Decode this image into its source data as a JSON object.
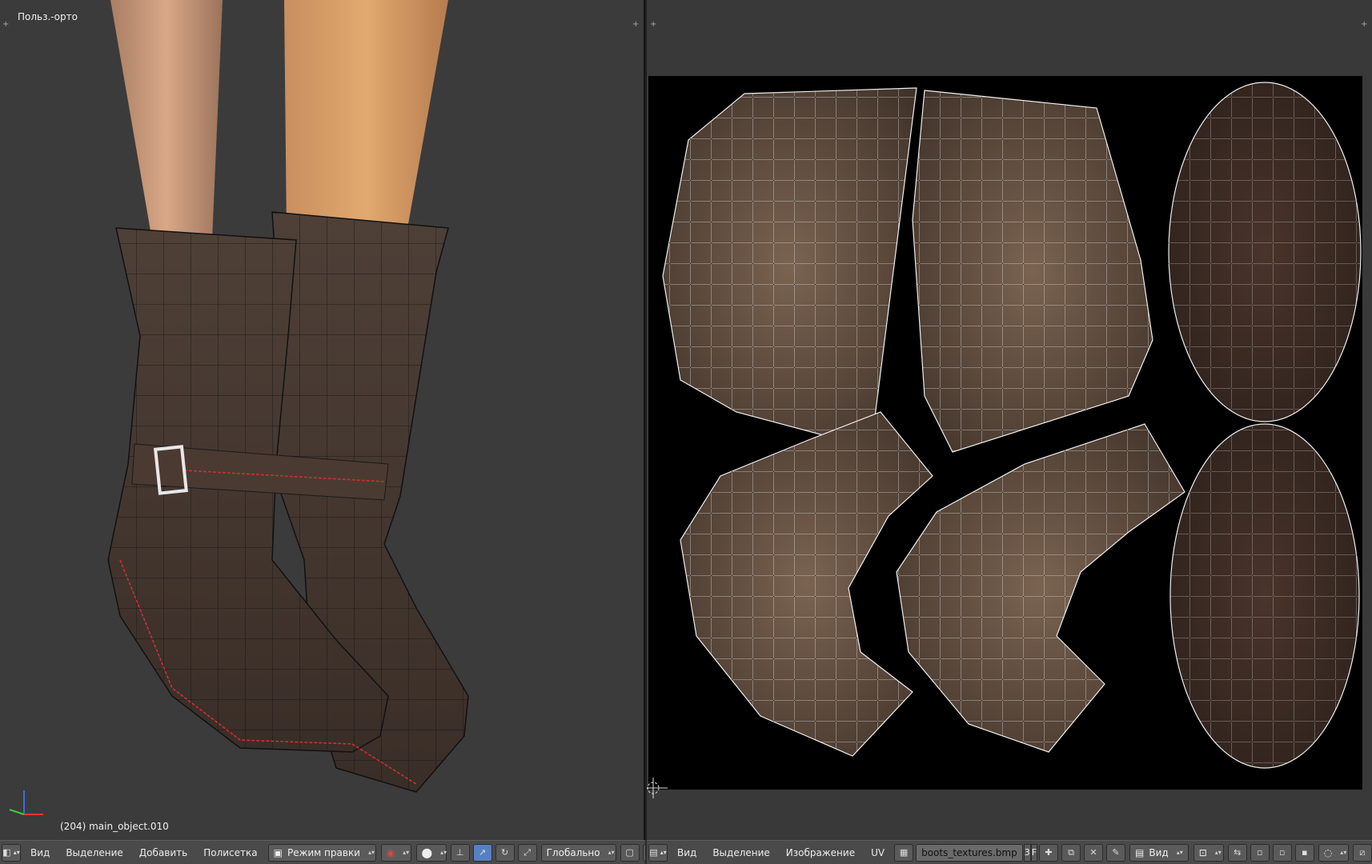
{
  "viewport": {
    "view_label": "Польз.-орто",
    "object_label": "(204) main_object.010",
    "corner_glyph": "+"
  },
  "left_toolbar": {
    "menu": [
      "Вид",
      "Выделение",
      "Добавить",
      "Полисетка"
    ],
    "mode": "Режим правки",
    "orientation": "Глобально"
  },
  "right_toolbar": {
    "menu": [
      "Вид",
      "Выделение",
      "Изображение",
      "UV"
    ],
    "image_name": "boots_textures.bmp",
    "users_count": "3",
    "fake_user": "F",
    "view": "Вид"
  },
  "icons": {
    "editor_type": "cube-icon",
    "mode_icon": "edit-mode-icon",
    "pivot": "pivot-icon",
    "image_icon": "image-icon"
  },
  "colors": {
    "viewport_bg": "#3b3b3b",
    "toolbar_bg": "#4a4a4a",
    "accent": "#5680c2",
    "leather": "#4a3b32",
    "uv_leather": "#6b5645",
    "seam": "#e03030"
  }
}
